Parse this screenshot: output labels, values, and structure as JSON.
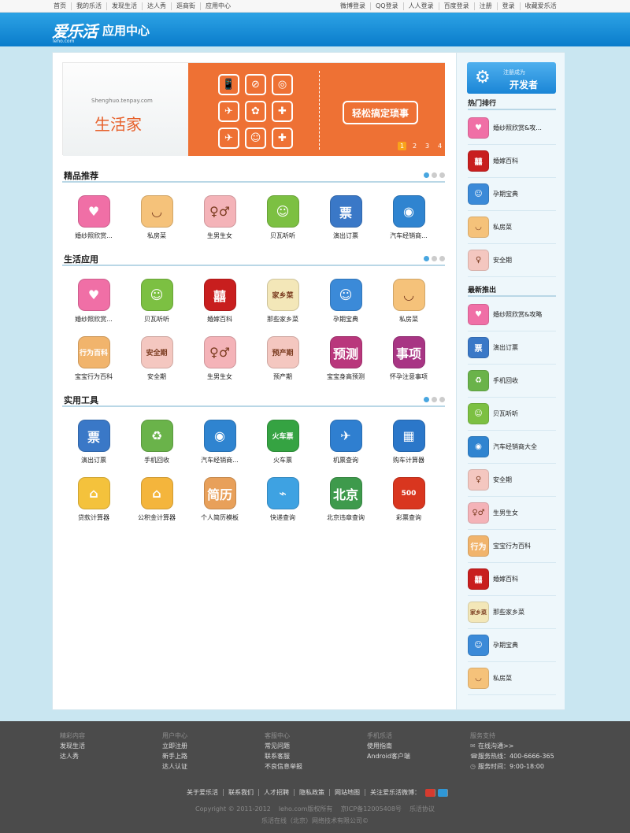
{
  "topnav": {
    "left": [
      "首页",
      "我的乐活",
      "发现生活",
      "达人秀",
      "逛商街",
      "应用中心"
    ],
    "right": [
      "微博登录",
      "QQ登录",
      "人人登录",
      "百度登录",
      "注册",
      "登录",
      "收藏爱乐活"
    ]
  },
  "header": {
    "logo": "爱乐活",
    "logo_sub": "leho.com",
    "title": "应用中心"
  },
  "banner": {
    "url": "Shenghuo.tenpay.com",
    "brand": "生活家",
    "slogan": "轻松搞定琐事",
    "pages": [
      "1",
      "2",
      "3",
      "4"
    ],
    "active_page": "1",
    "icons": [
      "📱",
      "⊘",
      "◎",
      "✈",
      "✿",
      "✚",
      "✈",
      "☺",
      "✚"
    ]
  },
  "sections": [
    {
      "title": "精品推荐",
      "apps": [
        {
          "label": "婚纱照欣赏...",
          "icon": "wedding-photo-icon",
          "text": "♥",
          "color": "#f06fa6"
        },
        {
          "label": "私房菜",
          "icon": "home-cooking-icon",
          "text": "◡",
          "color": "#f5c27a"
        },
        {
          "label": "生男生女",
          "icon": "baby-gender-icon",
          "text": "♀♂",
          "color": "#f4b3b8"
        },
        {
          "label": "贝瓦听听",
          "icon": "beva-listen-icon",
          "text": "☺",
          "color": "#7cc042"
        },
        {
          "label": "演出订票",
          "icon": "ticket-icon",
          "text": "票",
          "color": "#3a78c7"
        },
        {
          "label": "汽车经销商...",
          "icon": "car-dealer-icon",
          "text": "◉",
          "color": "#2f84d0"
        }
      ]
    },
    {
      "title": "生活应用",
      "apps": [
        {
          "label": "婚纱照欣赏...",
          "icon": "wedding-photo-icon",
          "text": "♥",
          "color": "#f06fa6"
        },
        {
          "label": "贝瓦听听",
          "icon": "beva-listen-icon",
          "text": "☺",
          "color": "#7cc042"
        },
        {
          "label": "婚嫁百科",
          "icon": "wedding-encyclopedia-icon",
          "text": "囍",
          "color": "#c81e1e"
        },
        {
          "label": "那些家乡菜",
          "icon": "hometown-dish-icon",
          "text": "家乡菜",
          "color": "#f3e7b8"
        },
        {
          "label": "孕期宝典",
          "icon": "pregnancy-guide-icon",
          "text": "☺",
          "color": "#3b8ad8"
        },
        {
          "label": "私房菜",
          "icon": "home-cooking-icon",
          "text": "◡",
          "color": "#f5c27a"
        },
        {
          "label": "宝宝行为百科",
          "icon": "baby-behavior-icon",
          "text": "行为百科",
          "color": "#f1b46c"
        },
        {
          "label": "安全期",
          "icon": "safe-period-icon",
          "text": "安全期",
          "color": "#f4c7c0"
        },
        {
          "label": "生男生女",
          "icon": "baby-gender-icon",
          "text": "♀♂",
          "color": "#f4b3b8"
        },
        {
          "label": "预产期",
          "icon": "due-date-icon",
          "text": "预产期",
          "color": "#f4c7c0"
        },
        {
          "label": "宝宝身高预测",
          "icon": "baby-height-icon",
          "text": "预测",
          "color": "#b9377c"
        },
        {
          "label": "怀孕注意事项",
          "icon": "pregnancy-notes-icon",
          "text": "事项",
          "color": "#a83584"
        }
      ]
    },
    {
      "title": "实用工具",
      "apps": [
        {
          "label": "演出订票",
          "icon": "ticket-icon",
          "text": "票",
          "color": "#3a78c7"
        },
        {
          "label": "手机回收",
          "icon": "phone-recycle-icon",
          "text": "♻",
          "color": "#6ab34a"
        },
        {
          "label": "汽车经销商...",
          "icon": "car-dealer-icon",
          "text": "◉",
          "color": "#2f84d0"
        },
        {
          "label": "火车票",
          "icon": "train-ticket-icon",
          "text": "火车票",
          "color": "#35a342"
        },
        {
          "label": "机票查询",
          "icon": "flight-search-icon",
          "text": "✈",
          "color": "#2f7fd0"
        },
        {
          "label": "购车计算器",
          "icon": "car-calculator-icon",
          "text": "▦",
          "color": "#2b77c9"
        },
        {
          "label": "贷款计算器",
          "icon": "loan-calculator-icon",
          "text": "⌂",
          "color": "#f4c23c"
        },
        {
          "label": "公积金计算器",
          "icon": "housing-fund-icon",
          "text": "⌂",
          "color": "#f4b53c"
        },
        {
          "label": "个人简历模板",
          "icon": "resume-template-icon",
          "text": "简历",
          "color": "#e8a05a"
        },
        {
          "label": "快递查询",
          "icon": "express-search-icon",
          "text": "⌁",
          "color": "#3ea2e2"
        },
        {
          "label": "北京违章查询",
          "icon": "traffic-violation-icon",
          "text": "北京",
          "color": "#3e9a4c"
        },
        {
          "label": "彩票查询",
          "icon": "lottery-icon",
          "text": "500",
          "color": "#d9361f"
        }
      ]
    }
  ],
  "sidebar": {
    "dev_small": "注册成为",
    "dev_big": "开发者",
    "hot_title": "热门排行",
    "hot": [
      {
        "label": "婚纱照欣赏&攻...",
        "icon": "wedding-photo-icon",
        "text": "♥",
        "color": "#f06fa6"
      },
      {
        "label": "婚嫁百科",
        "icon": "wedding-encyclopedia-icon",
        "text": "囍",
        "color": "#c81e1e"
      },
      {
        "label": "孕期宝典",
        "icon": "pregnancy-guide-icon",
        "text": "☺",
        "color": "#3b8ad8"
      },
      {
        "label": "私房菜",
        "icon": "home-cooking-icon",
        "text": "◡",
        "color": "#f5c27a"
      },
      {
        "label": "安全期",
        "icon": "safe-period-icon",
        "text": "♀",
        "color": "#f4c7c0"
      }
    ],
    "new_title": "最新推出",
    "new": [
      {
        "label": "婚纱照欣赏&攻略",
        "icon": "wedding-photo-icon",
        "text": "♥",
        "color": "#f06fa6"
      },
      {
        "label": "演出订票",
        "icon": "ticket-icon",
        "text": "票",
        "color": "#3a78c7"
      },
      {
        "label": "手机回收",
        "icon": "phone-recycle-icon",
        "text": "♻",
        "color": "#6ab34a"
      },
      {
        "label": "贝瓦听听",
        "icon": "beva-listen-icon",
        "text": "☺",
        "color": "#7cc042"
      },
      {
        "label": "汽车经销商大全",
        "icon": "car-dealer-icon",
        "text": "◉",
        "color": "#2f84d0"
      },
      {
        "label": "安全期",
        "icon": "safe-period-icon",
        "text": "♀",
        "color": "#f4c7c0"
      },
      {
        "label": "生男生女",
        "icon": "baby-gender-icon",
        "text": "♀♂",
        "color": "#f4b3b8"
      },
      {
        "label": "宝宝行为百科",
        "icon": "baby-behavior-icon",
        "text": "行为",
        "color": "#f1b46c"
      },
      {
        "label": "婚嫁百科",
        "icon": "wedding-encyclopedia-icon",
        "text": "囍",
        "color": "#c81e1e"
      },
      {
        "label": "那些家乡菜",
        "icon": "hometown-dish-icon",
        "text": "家乡菜",
        "color": "#f3e7b8"
      },
      {
        "label": "孕期宝典",
        "icon": "pregnancy-guide-icon",
        "text": "☺",
        "color": "#3b8ad8"
      },
      {
        "label": "私房菜",
        "icon": "home-cooking-icon",
        "text": "◡",
        "color": "#f5c27a"
      }
    ]
  },
  "footer": {
    "cols": [
      {
        "title": "精彩内容",
        "links": [
          "发现生活",
          "达人秀"
        ]
      },
      {
        "title": "用户中心",
        "links": [
          "立即注册",
          "新手上路",
          "达人认证"
        ]
      },
      {
        "title": "客服中心",
        "links": [
          "常见问题",
          "联系客服",
          "不良信息举报"
        ]
      },
      {
        "title": "手机乐活",
        "links": [
          "使用指南",
          "Android客户端"
        ]
      },
      {
        "title": "服务支持",
        "links": [
          "在线沟通>>",
          "服务热线：400-6666-365",
          "服务时间：9:00-18:00"
        ]
      }
    ],
    "support_icons": [
      "chat-icon",
      "phone-icon",
      "clock-icon"
    ],
    "links": [
      "关于爱乐活",
      "联系我们",
      "人才招聘",
      "隐私政策",
      "网站地图",
      "关注爱乐活微博："
    ],
    "copyright": [
      "Copyright © 2011-2012",
      "leho.com版权所有",
      "京ICP备12005408号",
      "乐活协议"
    ],
    "company": "乐活在线（北京）网络技术有限公司©"
  }
}
